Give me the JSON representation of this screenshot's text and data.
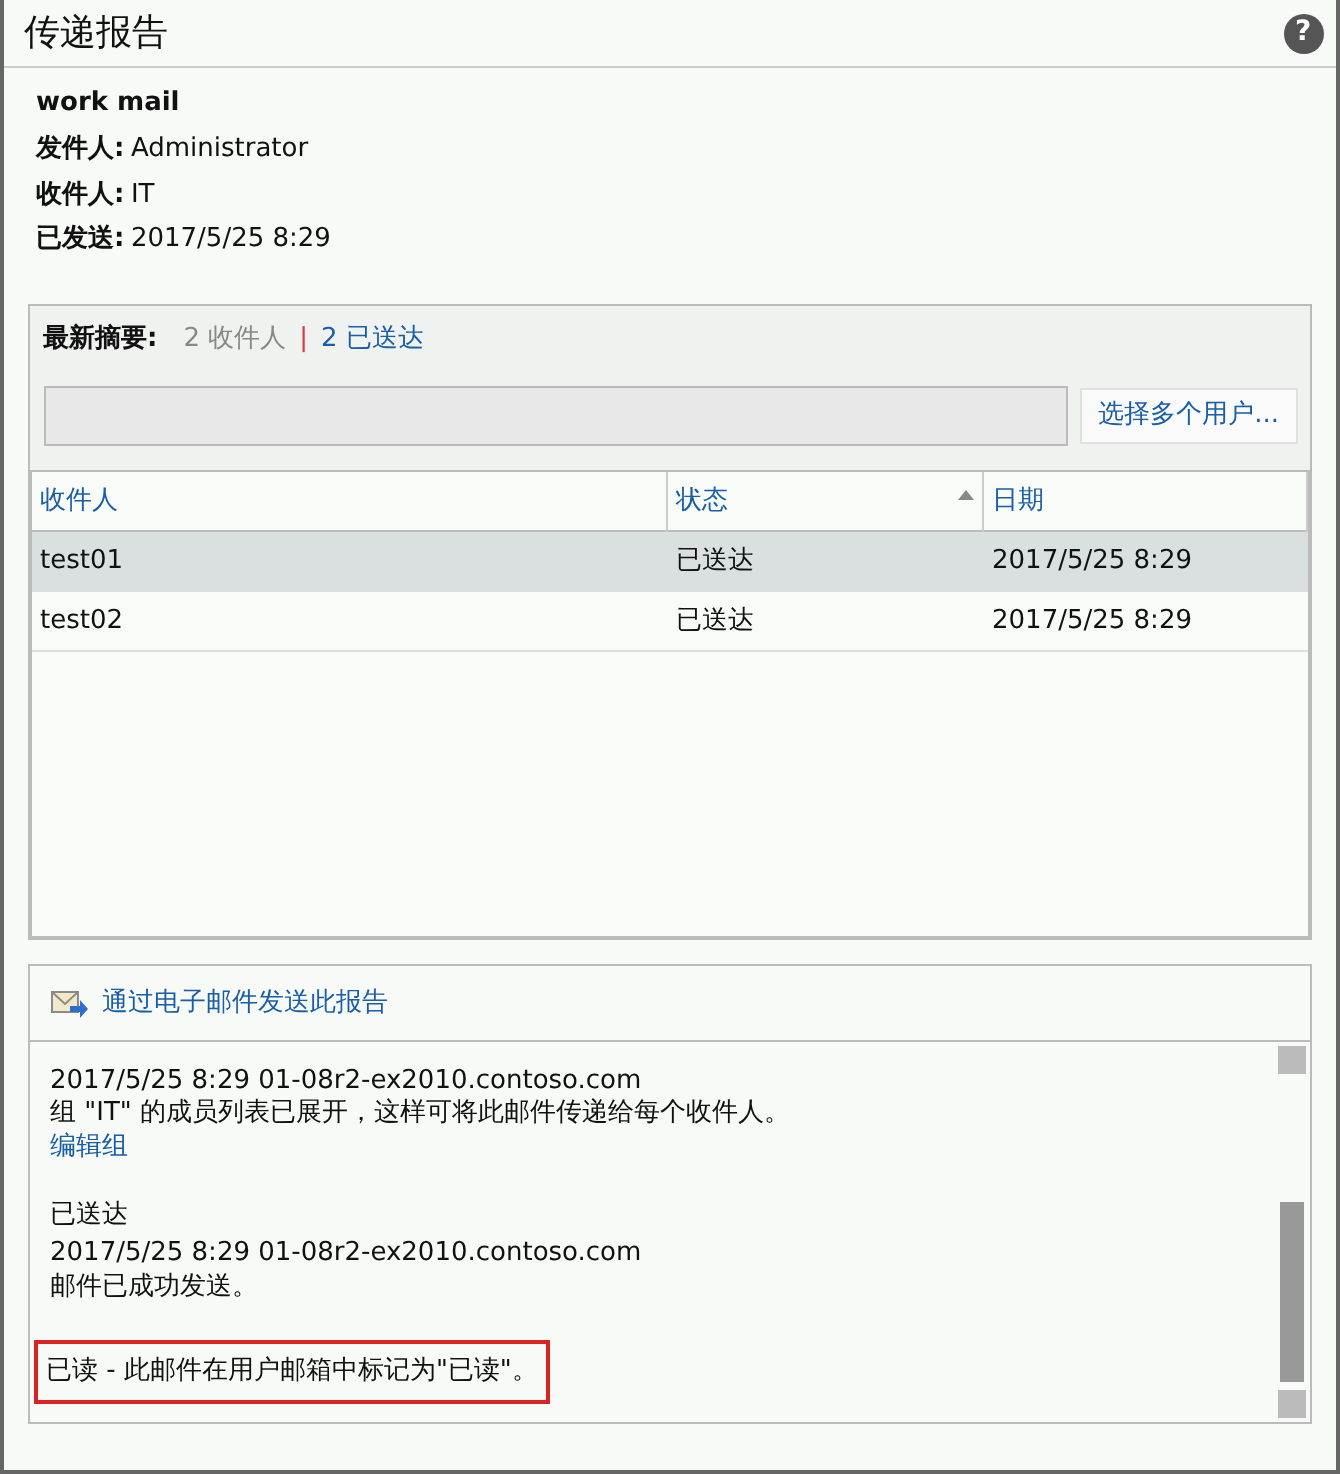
{
  "window": {
    "title": "传递报告",
    "help_glyph": "?"
  },
  "message": {
    "subject": "work mail",
    "fields": [
      {
        "label": "发件人:",
        "value": "Administrator"
      },
      {
        "label": "收件人:",
        "value": "IT"
      },
      {
        "label": "已发送:",
        "value": "2017/5/25 8:29"
      }
    ]
  },
  "summary": {
    "label": "最新摘要:",
    "recipients": "2 收件人",
    "separator": "|",
    "delivered": "2 已送达"
  },
  "search": {
    "button": "选择多个用户..."
  },
  "table": {
    "columns": [
      {
        "label": "收件人",
        "sorted": false
      },
      {
        "label": "状态",
        "sorted": true
      },
      {
        "label": "日期",
        "sorted": false
      }
    ],
    "rows": [
      {
        "cells": [
          "test01",
          "已送达",
          "2017/5/25 8:29"
        ],
        "selected": true
      },
      {
        "cells": [
          "test02",
          "已送达",
          "2017/5/25 8:29"
        ],
        "selected": false
      }
    ]
  },
  "email_link": "通过电子邮件发送此报告",
  "log": [
    {
      "meta": "2017/5/25 8:29 01-08r2-ex2010.contoso.com",
      "text": "组 \"IT\" 的成员列表已展开，这样可将此邮件传递给每个收件人。",
      "link": "编辑组",
      "highlighted": false
    },
    {
      "title": "已送达",
      "meta": "2017/5/25 8:29 01-08r2-ex2010.contoso.com",
      "text": "邮件已成功发送。",
      "highlighted": false
    },
    {
      "text": "已读  - 此邮件在用户邮箱中标记为\"已读\"。",
      "highlighted": true
    }
  ]
}
